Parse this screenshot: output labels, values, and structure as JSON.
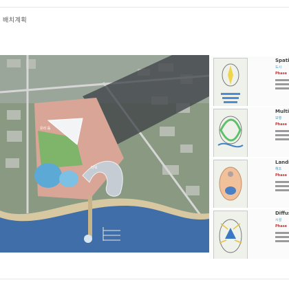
{
  "page": {
    "title": "배치계획"
  },
  "panels": [
    {
      "title": "Spatial",
      "sub": "도시",
      "phase": "Phase",
      "icon": "blue-arrow-diagram"
    },
    {
      "title": "Multi-u",
      "sub": "보행",
      "phase": "Phase",
      "icon": "green-loop-diagram"
    },
    {
      "title": "Landm",
      "sub": "해조",
      "phase": "Phase",
      "icon": "orange-landmark-diagram"
    },
    {
      "title": "Diffusi",
      "sub": "시설",
      "phase": "Phase",
      "icon": "blue-diffusion-diagram"
    }
  ],
  "map_labels": {
    "dome": "유리 돔",
    "tower": "타워"
  },
  "colors": {
    "sea": "#3f6ea8",
    "land": "#8a9a82",
    "plaza": "#d9a597",
    "dome": "#5da9d6",
    "accent": "#3aa0c8"
  }
}
